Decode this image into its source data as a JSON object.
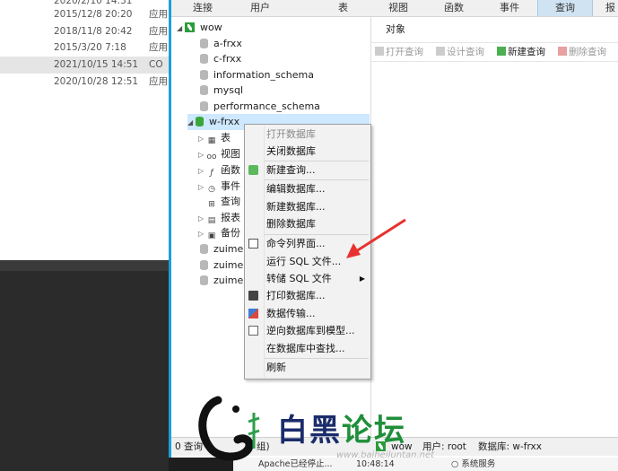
{
  "explorer": {
    "rows": [
      {
        "date": "2015/12/8 20:20",
        "type": "应用"
      },
      {
        "date": "2018/11/8 20:42",
        "type": "应用"
      },
      {
        "date": "2015/3/20 7:18",
        "type": "应用"
      },
      {
        "date": "2021/10/15 14:51",
        "type": "CO"
      },
      {
        "date": "2020/10/28 12:51",
        "type": "应用"
      }
    ]
  },
  "toolbar": {
    "items": [
      "连接",
      "用户",
      "表",
      "视图",
      "函数",
      "事件",
      "查询",
      "报"
    ]
  },
  "tree": {
    "connection": "wow",
    "databases": [
      "a-frxx",
      "c-frxx",
      "information_schema",
      "mysql",
      "performance_schema"
    ],
    "selected_db": "w-frxx",
    "children": [
      "表",
      "视图",
      "函数",
      "事件",
      "查询",
      "报表",
      "备份"
    ],
    "more_dbs": [
      "zuime",
      "zuime",
      "zuime"
    ]
  },
  "right": {
    "tab": "对象",
    "actions": [
      "打开查询",
      "设计查询",
      "新建查询",
      "删除查询"
    ]
  },
  "context_menu": {
    "items": [
      {
        "label": "打开数据库",
        "disabled": true
      },
      {
        "label": "关闭数据库",
        "disabled": false
      },
      {
        "label": "新建查询...",
        "disabled": false,
        "icon": "new-query-icon"
      },
      {
        "label": "编辑数据库...",
        "disabled": false
      },
      {
        "label": "新建数据库...",
        "disabled": false
      },
      {
        "label": "删除数据库",
        "disabled": false
      },
      {
        "label": "命令列界面...",
        "disabled": false,
        "icon": "console-icon"
      },
      {
        "label": "运行 SQL 文件...",
        "disabled": false
      },
      {
        "label": "转储 SQL 文件",
        "disabled": false,
        "submenu": true
      },
      {
        "label": "打印数据库...",
        "disabled": false,
        "icon": "printer-icon"
      },
      {
        "label": "数据传输...",
        "disabled": false,
        "icon": "transfer-icon"
      },
      {
        "label": "逆向数据库到模型...",
        "disabled": false,
        "icon": "model-icon"
      },
      {
        "label": "在数据库中查找...",
        "disabled": false
      },
      {
        "label": "刷新",
        "disabled": false
      }
    ]
  },
  "status": {
    "left": "0 查询",
    "grp": "组)",
    "conn": "wow",
    "user": "用户: root",
    "db": "数据库: w-frxx"
  },
  "bottom": {
    "apache": "Apache已经停止...",
    "time": "10:48:14",
    "service": "系统服务"
  },
  "watermark": {
    "b": "白黑",
    "c": "论坛",
    "url": "www.baiheiluntan.net"
  },
  "colors": {
    "accent": "#1aa0d8",
    "selected": "#cde8ff",
    "arrow": "#e8322e"
  }
}
